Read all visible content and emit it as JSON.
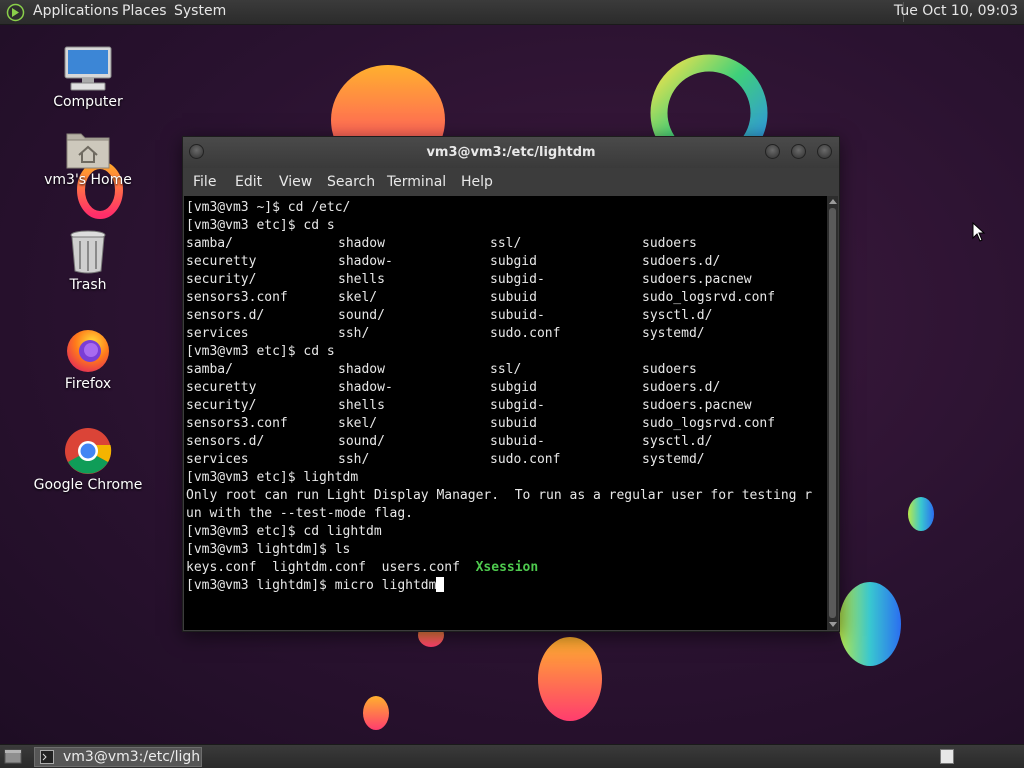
{
  "top_panel": {
    "menus": [
      "Applications",
      "Places",
      "System"
    ],
    "clock": "Tue Oct 10, 09:03"
  },
  "desktop": {
    "icons": [
      {
        "label": "Computer",
        "icon": "computer-icon"
      },
      {
        "label": "vm3's Home",
        "icon": "home-folder-icon"
      },
      {
        "label": "Trash",
        "icon": "trash-icon"
      },
      {
        "label": "Firefox",
        "icon": "firefox-icon"
      },
      {
        "label": "Google Chrome",
        "icon": "chrome-icon"
      }
    ]
  },
  "terminal": {
    "title": "vm3@vm3:/etc/lightdm",
    "menu": [
      "File",
      "Edit",
      "View",
      "Search",
      "Terminal",
      "Help"
    ],
    "lines": [
      {
        "type": "text",
        "text": "[vm3@vm3 ~]$ cd /etc/"
      },
      {
        "type": "text",
        "text": "[vm3@vm3 etc]$ cd s"
      },
      {
        "type": "cols",
        "cells": [
          "samba/",
          "shadow",
          "ssl/",
          "sudoers"
        ]
      },
      {
        "type": "cols",
        "cells": [
          "securetty",
          "shadow-",
          "subgid",
          "sudoers.d/"
        ]
      },
      {
        "type": "cols",
        "cells": [
          "security/",
          "shells",
          "subgid-",
          "sudoers.pacnew"
        ]
      },
      {
        "type": "cols",
        "cells": [
          "sensors3.conf",
          "skel/",
          "subuid",
          "sudo_logsrvd.conf"
        ]
      },
      {
        "type": "cols",
        "cells": [
          "sensors.d/",
          "sound/",
          "subuid-",
          "sysctl.d/"
        ]
      },
      {
        "type": "cols",
        "cells": [
          "services",
          "ssh/",
          "sudo.conf",
          "systemd/"
        ]
      },
      {
        "type": "text",
        "text": "[vm3@vm3 etc]$ cd s"
      },
      {
        "type": "cols",
        "cells": [
          "samba/",
          "shadow",
          "ssl/",
          "sudoers"
        ]
      },
      {
        "type": "cols",
        "cells": [
          "securetty",
          "shadow-",
          "subgid",
          "sudoers.d/"
        ]
      },
      {
        "type": "cols",
        "cells": [
          "security/",
          "shells",
          "subgid-",
          "sudoers.pacnew"
        ]
      },
      {
        "type": "cols",
        "cells": [
          "sensors3.conf",
          "skel/",
          "subuid",
          "sudo_logsrvd.conf"
        ]
      },
      {
        "type": "cols",
        "cells": [
          "sensors.d/",
          "sound/",
          "subuid-",
          "sysctl.d/"
        ]
      },
      {
        "type": "cols",
        "cells": [
          "services",
          "ssh/",
          "sudo.conf",
          "systemd/"
        ]
      },
      {
        "type": "text",
        "text": "[vm3@vm3 etc]$ lightdm"
      },
      {
        "type": "text",
        "text": "Only root can run Light Display Manager.  To run as a regular user for testing r"
      },
      {
        "type": "text",
        "text": "un with the --test-mode flag."
      },
      {
        "type": "text",
        "text": "[vm3@vm3 etc]$ cd lightdm"
      },
      {
        "type": "text",
        "text": "[vm3@vm3 lightdm]$ ls"
      },
      {
        "type": "ls",
        "plain": "keys.conf  lightdm.conf  users.conf  ",
        "highlight": "Xsession"
      },
      {
        "type": "prompt",
        "text": "[vm3@vm3 lightdm]$ micro lightdm"
      }
    ]
  },
  "bottom_panel": {
    "task_label": "vm3@vm3:/etc/ligh..."
  },
  "colors": {
    "executable_green": "#4ec94e",
    "terminal_bg": "#000000"
  }
}
